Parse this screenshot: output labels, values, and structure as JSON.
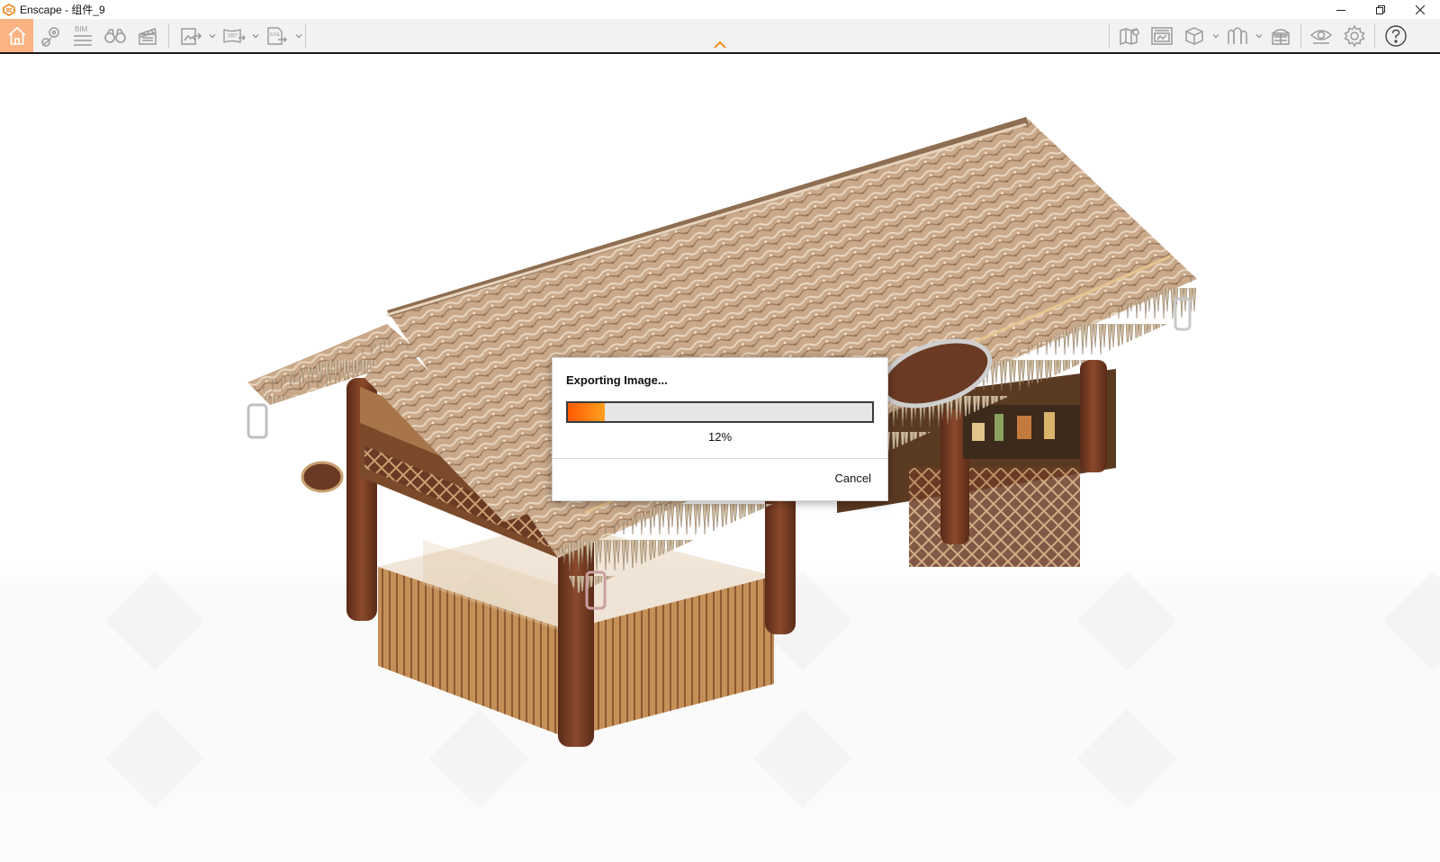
{
  "window": {
    "title": "Enscape - 组件_9",
    "brand_color": "#f28c28"
  },
  "toolbar": {
    "accent": "#fbb383",
    "left_buttons": [
      {
        "icon": "home-icon",
        "active": true
      },
      {
        "icon": "map-pin-icon"
      },
      {
        "icon": "bim-icon",
        "label": "BIM"
      },
      {
        "icon": "binoculars-icon"
      },
      {
        "icon": "clapperboard-icon"
      },
      {
        "icon": "image-export-icon",
        "dropdown": true
      },
      {
        "icon": "panorama-360-icon",
        "label": "360°",
        "dropdown": true
      },
      {
        "icon": "exe-export-icon",
        "label": "EXE",
        "dropdown": true
      }
    ],
    "right_buttons": [
      {
        "icon": "map-icon"
      },
      {
        "icon": "screen-capture-icon"
      },
      {
        "icon": "cube-icon",
        "dropdown": true
      },
      {
        "icon": "materials-icon",
        "dropdown": true
      },
      {
        "icon": "asset-library-icon"
      },
      {
        "icon": "eye-icon"
      },
      {
        "icon": "gear-icon"
      },
      {
        "icon": "help-icon"
      }
    ]
  },
  "dialog": {
    "title": "Exporting Image...",
    "progress": 0.12,
    "progress_text": "12%",
    "cancel_label": "Cancel"
  }
}
